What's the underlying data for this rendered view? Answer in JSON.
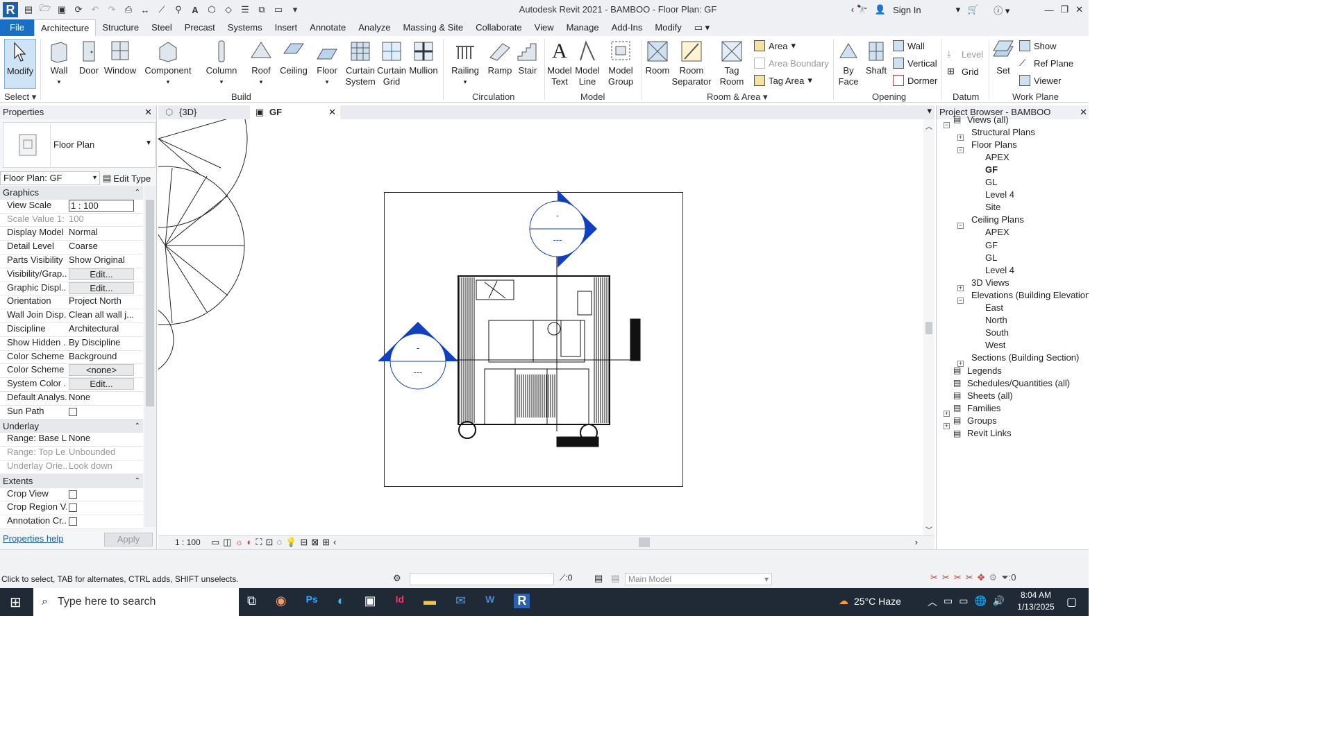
{
  "window": {
    "title": "Autodesk Revit 2021 - BAMBOO - Floor Plan: GF",
    "sign_in": "Sign In"
  },
  "menu_tabs": [
    "File",
    "Architecture",
    "Structure",
    "Steel",
    "Precast",
    "Systems",
    "Insert",
    "Annotate",
    "Analyze",
    "Massing & Site",
    "Collaborate",
    "View",
    "Manage",
    "Add-Ins",
    "Modify"
  ],
  "ribbon": {
    "select": {
      "modify": "Modify",
      "select": "Select"
    },
    "build": {
      "label": "Build",
      "wall": "Wall",
      "door": "Door",
      "window": "Window",
      "component": "Component",
      "column": "Column",
      "roof": "Roof",
      "ceiling": "Ceiling",
      "floor": "Floor",
      "curtain_system": "Curtain System",
      "curtain_grid": "Curtain Grid",
      "mullion": "Mullion"
    },
    "circulation": {
      "label": "Circulation",
      "railing": "Railing",
      "ramp": "Ramp",
      "stair": "Stair"
    },
    "model": {
      "label": "Model",
      "model_text": "Model Text",
      "model_line": "Model Line",
      "model_group": "Model Group"
    },
    "room_area": {
      "label": "Room & Area",
      "room": "Room",
      "room_separator": "Room Separator",
      "tag_room": "Tag Room",
      "area": "Area",
      "area_boundary": "Area Boundary",
      "tag_area": "Tag Area"
    },
    "opening": {
      "label": "Opening",
      "by_face": "By Face",
      "shaft": "Shaft",
      "wall": "Wall",
      "vertical": "Vertical",
      "dormer": "Dormer"
    },
    "datum": {
      "label": "Datum",
      "level": "Level",
      "grid": "Grid"
    },
    "work_plane": {
      "label": "Work Plane",
      "set": "Set",
      "show": "Show",
      "ref_plane": "Ref Plane",
      "viewer": "Viewer"
    }
  },
  "properties": {
    "title": "Properties",
    "type_name": "Floor Plan",
    "selector": "Floor Plan: GF",
    "edit_type": "Edit Type",
    "sections": {
      "graphics": "Graphics",
      "underlay": "Underlay",
      "extents": "Extents"
    },
    "rows": [
      {
        "k": "View Scale",
        "v": "1 : 100"
      },
      {
        "k": "Scale Value    1:",
        "v": "100"
      },
      {
        "k": "Display Model",
        "v": "Normal"
      },
      {
        "k": "Detail Level",
        "v": "Coarse"
      },
      {
        "k": "Parts Visibility",
        "v": "Show Original"
      },
      {
        "k": "Visibility/Grap...",
        "v": "Edit..."
      },
      {
        "k": "Graphic Displ...",
        "v": "Edit..."
      },
      {
        "k": "Orientation",
        "v": "Project North"
      },
      {
        "k": "Wall Join Disp...",
        "v": "Clean all wall j..."
      },
      {
        "k": "Discipline",
        "v": "Architectural"
      },
      {
        "k": "Show Hidden ...",
        "v": "By Discipline"
      },
      {
        "k": "Color Scheme ...",
        "v": "Background"
      },
      {
        "k": "Color Scheme",
        "v": "<none>"
      },
      {
        "k": "System Color ...",
        "v": "Edit..."
      },
      {
        "k": "Default Analys...",
        "v": "None"
      },
      {
        "k": "Sun Path",
        "v": ""
      },
      {
        "k": "Range: Base L...",
        "v": "None"
      },
      {
        "k": "Range: Top Le...",
        "v": "Unbounded"
      },
      {
        "k": "Underlay Orie...",
        "v": "Look down"
      },
      {
        "k": "Crop View",
        "v": ""
      },
      {
        "k": "Crop Region V...",
        "v": ""
      },
      {
        "k": "Annotation Cr...",
        "v": ""
      }
    ],
    "help": "Properties help",
    "apply": "Apply"
  },
  "view_tabs": [
    {
      "label": "{3D}"
    },
    {
      "label": "GF"
    }
  ],
  "view_bar": {
    "scale": "1 : 100"
  },
  "elevation_markers": {
    "top_symbol": "-",
    "bottom_symbol": "---"
  },
  "project_browser": {
    "title": "Project Browser - BAMBOO",
    "nodes": [
      {
        "label": "Views (all)",
        "level": 0,
        "box": "-"
      },
      {
        "label": "Structural Plans",
        "level": 1,
        "box": "+"
      },
      {
        "label": "Floor Plans",
        "level": 1,
        "box": "-"
      },
      {
        "label": "APEX",
        "level": 2,
        "box": ""
      },
      {
        "label": "GF",
        "level": 2,
        "box": "",
        "bold": true
      },
      {
        "label": "GL",
        "level": 2,
        "box": ""
      },
      {
        "label": "Level 4",
        "level": 2,
        "box": ""
      },
      {
        "label": "Site",
        "level": 2,
        "box": ""
      },
      {
        "label": "Ceiling Plans",
        "level": 1,
        "box": "-"
      },
      {
        "label": "APEX",
        "level": 2,
        "box": ""
      },
      {
        "label": "GF",
        "level": 2,
        "box": ""
      },
      {
        "label": "GL",
        "level": 2,
        "box": ""
      },
      {
        "label": "Level 4",
        "level": 2,
        "box": ""
      },
      {
        "label": "3D Views",
        "level": 1,
        "box": "+"
      },
      {
        "label": "Elevations (Building Elevation)",
        "level": 1,
        "box": "-"
      },
      {
        "label": "East",
        "level": 2,
        "box": ""
      },
      {
        "label": "North",
        "level": 2,
        "box": ""
      },
      {
        "label": "South",
        "level": 2,
        "box": ""
      },
      {
        "label": "West",
        "level": 2,
        "box": ""
      },
      {
        "label": "Sections (Building Section)",
        "level": 1,
        "box": "+"
      },
      {
        "label": "Legends",
        "level": 0,
        "box": ""
      },
      {
        "label": "Schedules/Quantities (all)",
        "level": 0,
        "box": ""
      },
      {
        "label": "Sheets (all)",
        "level": 0,
        "box": ""
      },
      {
        "label": "Families",
        "level": 0,
        "box": "+"
      },
      {
        "label": "Groups",
        "level": 0,
        "box": "+"
      },
      {
        "label": "Revit Links",
        "level": 0,
        "box": ""
      }
    ]
  },
  "status_bar": {
    "hint": "Click to select, TAB for alternates, CTRL adds, SHIFT unselects.",
    "sel_count": ":0",
    "workset": "Main Model",
    "filter_count": ":0"
  },
  "taskbar": {
    "search_placeholder": "Type here to search",
    "weather": "25°C  Haze",
    "time": "8:04 AM",
    "date": "1/13/2025"
  },
  "colors": {
    "file_tab": "#1a6fc4",
    "elev_blue": "#1040c0",
    "taskbar": "#1f2a36"
  }
}
